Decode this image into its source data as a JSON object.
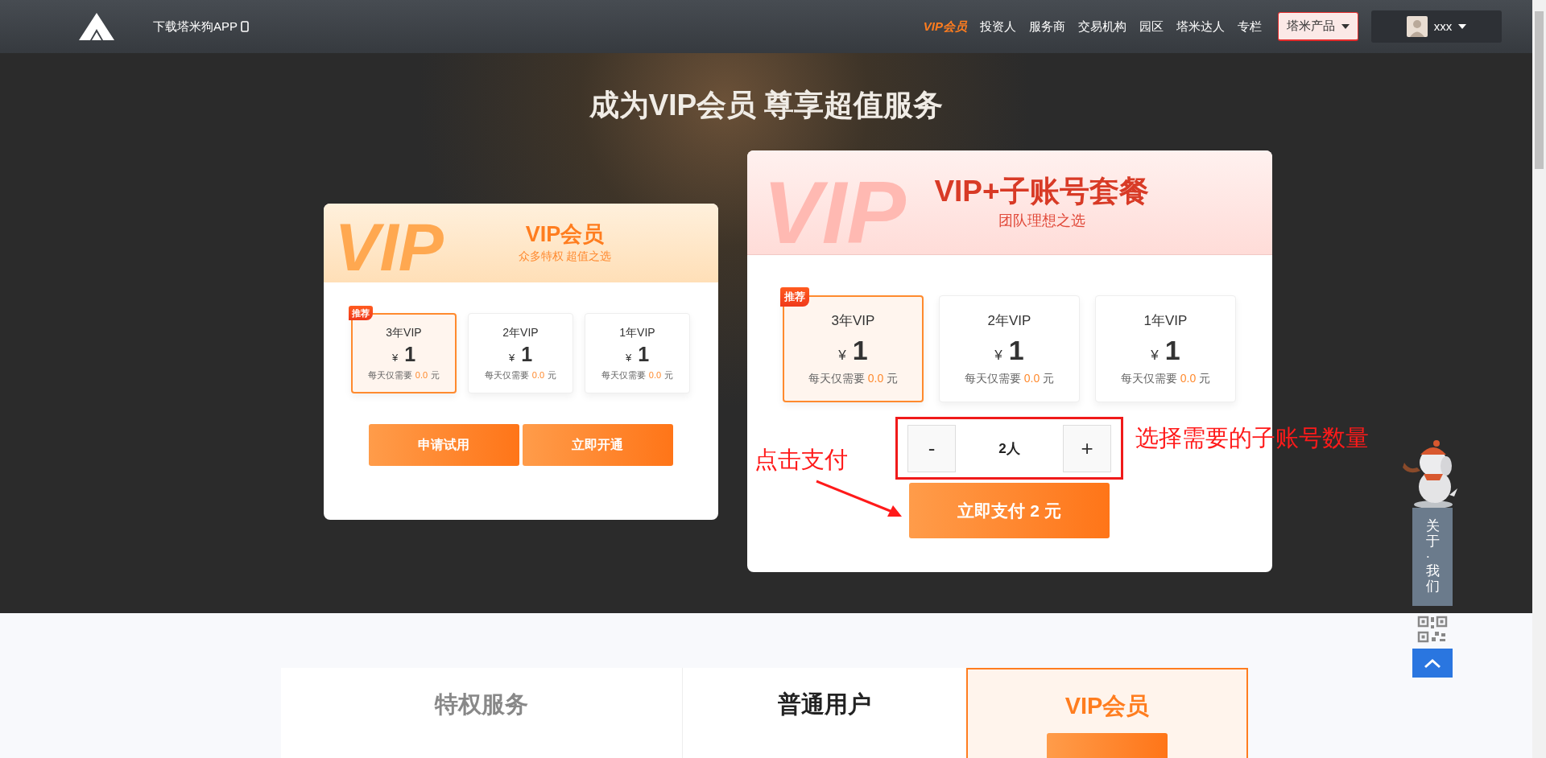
{
  "navbar": {
    "download_link": "下载塔米狗APP",
    "items": [
      {
        "label": "VIP会员",
        "selected": true
      },
      {
        "label": "投资人",
        "selected": false
      },
      {
        "label": "服务商",
        "selected": false
      },
      {
        "label": "交易机构",
        "selected": false
      },
      {
        "label": "园区",
        "selected": false
      },
      {
        "label": "塔米达人",
        "selected": false
      },
      {
        "label": "专栏",
        "selected": false
      }
    ],
    "products_dropdown": "塔米产品",
    "user_menu": "xxx"
  },
  "hero": {
    "title": "成为VIP会员 尊享超值服务"
  },
  "plans": [
    {
      "kind": "basic",
      "background_text": "VIP",
      "title": "VIP会员",
      "subtitle": "众多特权 超值之选",
      "options": [
        {
          "name": "3年VIP",
          "currency": "¥",
          "price": "1",
          "per_day_label": "每天仅需要",
          "per_day": "0.0",
          "unit": "元",
          "selected": true,
          "badge": "推荐"
        },
        {
          "name": "2年VIP",
          "currency": "¥",
          "price": "1",
          "per_day_label": "每天仅需要",
          "per_day": "0.0",
          "unit": "元",
          "selected": false
        },
        {
          "name": "1年VIP",
          "currency": "¥",
          "price": "1",
          "per_day_label": "每天仅需要",
          "per_day": "0.0",
          "unit": "元",
          "selected": false
        }
      ],
      "buttons": [
        "申请试用",
        "立即开通"
      ]
    },
    {
      "kind": "team",
      "background_text": "VIP",
      "title": "VIP+子账号套餐",
      "subtitle": "团队理想之选",
      "options": [
        {
          "name": "3年VIP",
          "currency": "¥",
          "price": "1",
          "per_day_label": "每天仅需要",
          "per_day": "0.0",
          "unit": "元",
          "selected": true,
          "badge": "推荐"
        },
        {
          "name": "2年VIP",
          "currency": "¥",
          "price": "1",
          "per_day_label": "每天仅需要",
          "per_day": "0.0",
          "unit": "元",
          "selected": false
        },
        {
          "name": "1年VIP",
          "currency": "¥",
          "price": "1",
          "per_day_label": "每天仅需要",
          "per_day": "0.0",
          "unit": "元",
          "selected": false
        }
      ],
      "stepper": {
        "minus": "-",
        "value": "2人",
        "plus": "+"
      },
      "pay_button": "立即支付 2 元",
      "annotations": [
        {
          "kind": "left",
          "text": "点击支付"
        },
        {
          "kind": "right",
          "text": "选择需要的子账号数量"
        }
      ]
    }
  ],
  "side_widget": {
    "about": "关于·我们"
  },
  "comparison": {
    "columns": [
      {
        "kind": "label",
        "title": "特权服务"
      },
      {
        "kind": "normal",
        "title": "普通用户"
      },
      {
        "kind": "vip",
        "title": "VIP会员"
      }
    ]
  }
}
